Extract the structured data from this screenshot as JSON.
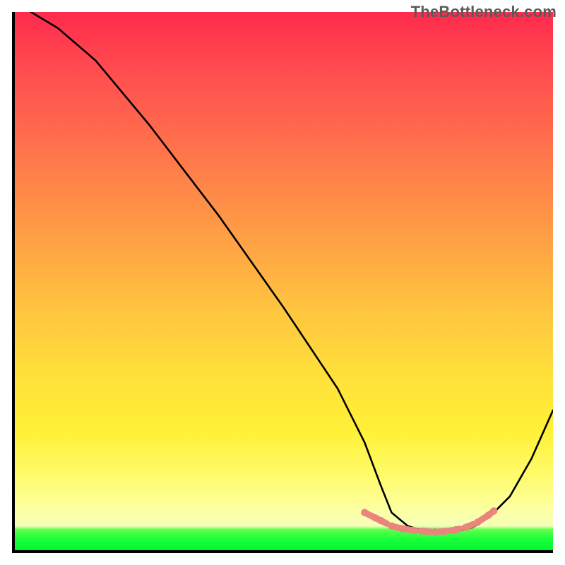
{
  "watermark": "TheBottleneck.com",
  "chart_data": {
    "type": "line",
    "title": "",
    "xlabel": "",
    "ylabel": "",
    "xlim": [
      0,
      100
    ],
    "ylim": [
      0,
      100
    ],
    "grid": false,
    "legend": false,
    "background": {
      "kind": "vertical-gradient",
      "stops": [
        {
          "pos": 0,
          "color": "#ff2a4d"
        },
        {
          "pos": 40,
          "color": "#ff9a46"
        },
        {
          "pos": 68,
          "color": "#ffe13a"
        },
        {
          "pos": 92,
          "color": "#fdff9e"
        },
        {
          "pos": 97,
          "color": "#17ff3a"
        },
        {
          "pos": 100,
          "color": "#00f830"
        }
      ]
    },
    "series": [
      {
        "name": "bottleneck-curve",
        "color": "#000000",
        "x": [
          3,
          8,
          15,
          25,
          38,
          50,
          60,
          65,
          68,
          70,
          73,
          76,
          79,
          82,
          85,
          88,
          92,
          96,
          100
        ],
        "y": [
          100,
          97,
          91,
          79,
          62,
          45,
          30,
          20,
          12,
          7,
          4.5,
          3.6,
          3.4,
          3.5,
          4.2,
          6,
          10,
          17,
          26
        ]
      }
    ],
    "marker_band": {
      "name": "optimal-range",
      "color": "#e9857d",
      "points": [
        {
          "x": 65,
          "y": 7.0
        },
        {
          "x": 67,
          "y": 6.0
        },
        {
          "x": 68,
          "y": 5.5
        },
        {
          "x": 70,
          "y": 4.5
        },
        {
          "x": 72,
          "y": 4.0
        },
        {
          "x": 74,
          "y": 3.7
        },
        {
          "x": 76,
          "y": 3.5
        },
        {
          "x": 78,
          "y": 3.4
        },
        {
          "x": 80,
          "y": 3.5
        },
        {
          "x": 82,
          "y": 3.8
        },
        {
          "x": 84,
          "y": 4.3
        },
        {
          "x": 86,
          "y": 5.2
        },
        {
          "x": 88,
          "y": 6.5
        },
        {
          "x": 89,
          "y": 7.3
        }
      ]
    }
  }
}
